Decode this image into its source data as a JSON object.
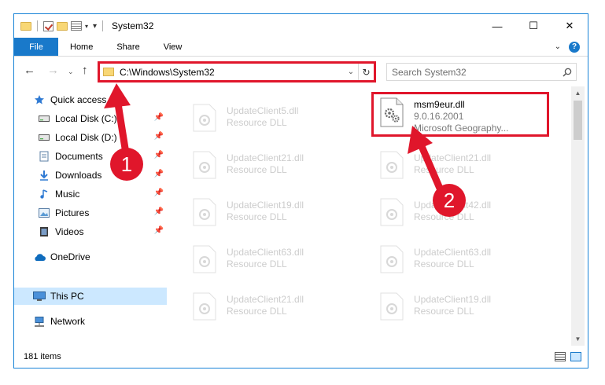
{
  "window": {
    "title": "System32",
    "controls": {
      "minimize": "—",
      "maximize": "☐",
      "close": "✕"
    }
  },
  "ribbon": {
    "tabs": [
      "File",
      "Home",
      "Share",
      "View"
    ],
    "help": "?"
  },
  "address": {
    "path": "C:\\Windows\\System32",
    "search_placeholder": "Search System32"
  },
  "nav": {
    "items": [
      {
        "label": "Quick access",
        "icon": "star-icon"
      },
      {
        "label": "Local Disk (C:)",
        "icon": "drive-icon",
        "pinned": true
      },
      {
        "label": "Local Disk (D:)",
        "icon": "drive-icon",
        "pinned": true
      },
      {
        "label": "Documents",
        "icon": "documents-icon",
        "pinned": true
      },
      {
        "label": "Downloads",
        "icon": "download-icon",
        "pinned": true
      },
      {
        "label": "Music",
        "icon": "music-icon",
        "pinned": true
      },
      {
        "label": "Pictures",
        "icon": "pictures-icon",
        "pinned": true
      },
      {
        "label": "Videos",
        "icon": "videos-icon",
        "pinned": true
      },
      {
        "label": "OneDrive",
        "icon": "cloud-icon"
      },
      {
        "label": "This PC",
        "icon": "computer-icon",
        "selected": true
      },
      {
        "label": "Network",
        "icon": "network-icon"
      }
    ]
  },
  "files": {
    "highlighted": {
      "name": "msm9eur.dll",
      "version": "9.0.16.2001",
      "description": "Microsoft Geography..."
    },
    "left": [
      {
        "name": "UpdateClient5.dll",
        "type": "Resource DLL"
      },
      {
        "name": "UpdateClient21.dll",
        "type": "Resource DLL"
      },
      {
        "name": "UpdateClient19.dll",
        "type": "Resource DLL"
      },
      {
        "name": "UpdateClient63.dll",
        "type": "Resource DLL"
      },
      {
        "name": "UpdateClient21.dll",
        "type": "Resource DLL"
      }
    ],
    "right": [
      {
        "name": "UpdateClient21.dll",
        "type": "Resource DLL"
      },
      {
        "name": "UpdateClient42.dll",
        "type": "Resource DLL"
      },
      {
        "name": "UpdateClient63.dll",
        "type": "Resource DLL"
      },
      {
        "name": "UpdateClient19.dll",
        "type": "Resource DLL"
      }
    ]
  },
  "status": {
    "count": "181 items"
  },
  "annotations": {
    "step1": "1",
    "step2": "2",
    "color": "#e0162b"
  }
}
